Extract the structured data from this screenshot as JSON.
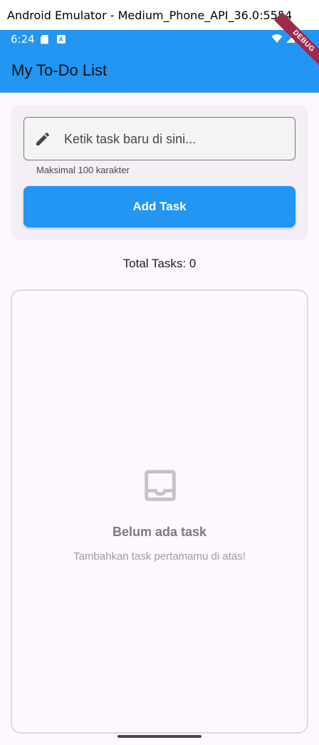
{
  "window": {
    "title": "Android Emulator - Medium_Phone_API_36.0:5554"
  },
  "statusbar": {
    "time": "6:24",
    "sd_icon": "sd-card-icon",
    "a_icon": "a-icon"
  },
  "debug_banner": "DEBUG",
  "appbar": {
    "title": "My To-Do List"
  },
  "input": {
    "placeholder": "Ketik task baru di sini...",
    "value": "",
    "helper": "Maksimal 100 karakter",
    "leading_icon": "pencil-icon"
  },
  "add_button": {
    "label": "Add Task"
  },
  "total": {
    "text": "Total Tasks: 0"
  },
  "empty_state": {
    "icon": "inbox-icon",
    "title": "Belum ada task",
    "subtitle": "Tambahkan task pertamamu di atas!"
  },
  "colors": {
    "primary": "#2196f3",
    "background": "#fdf7fe",
    "debug": "#a0284a"
  }
}
